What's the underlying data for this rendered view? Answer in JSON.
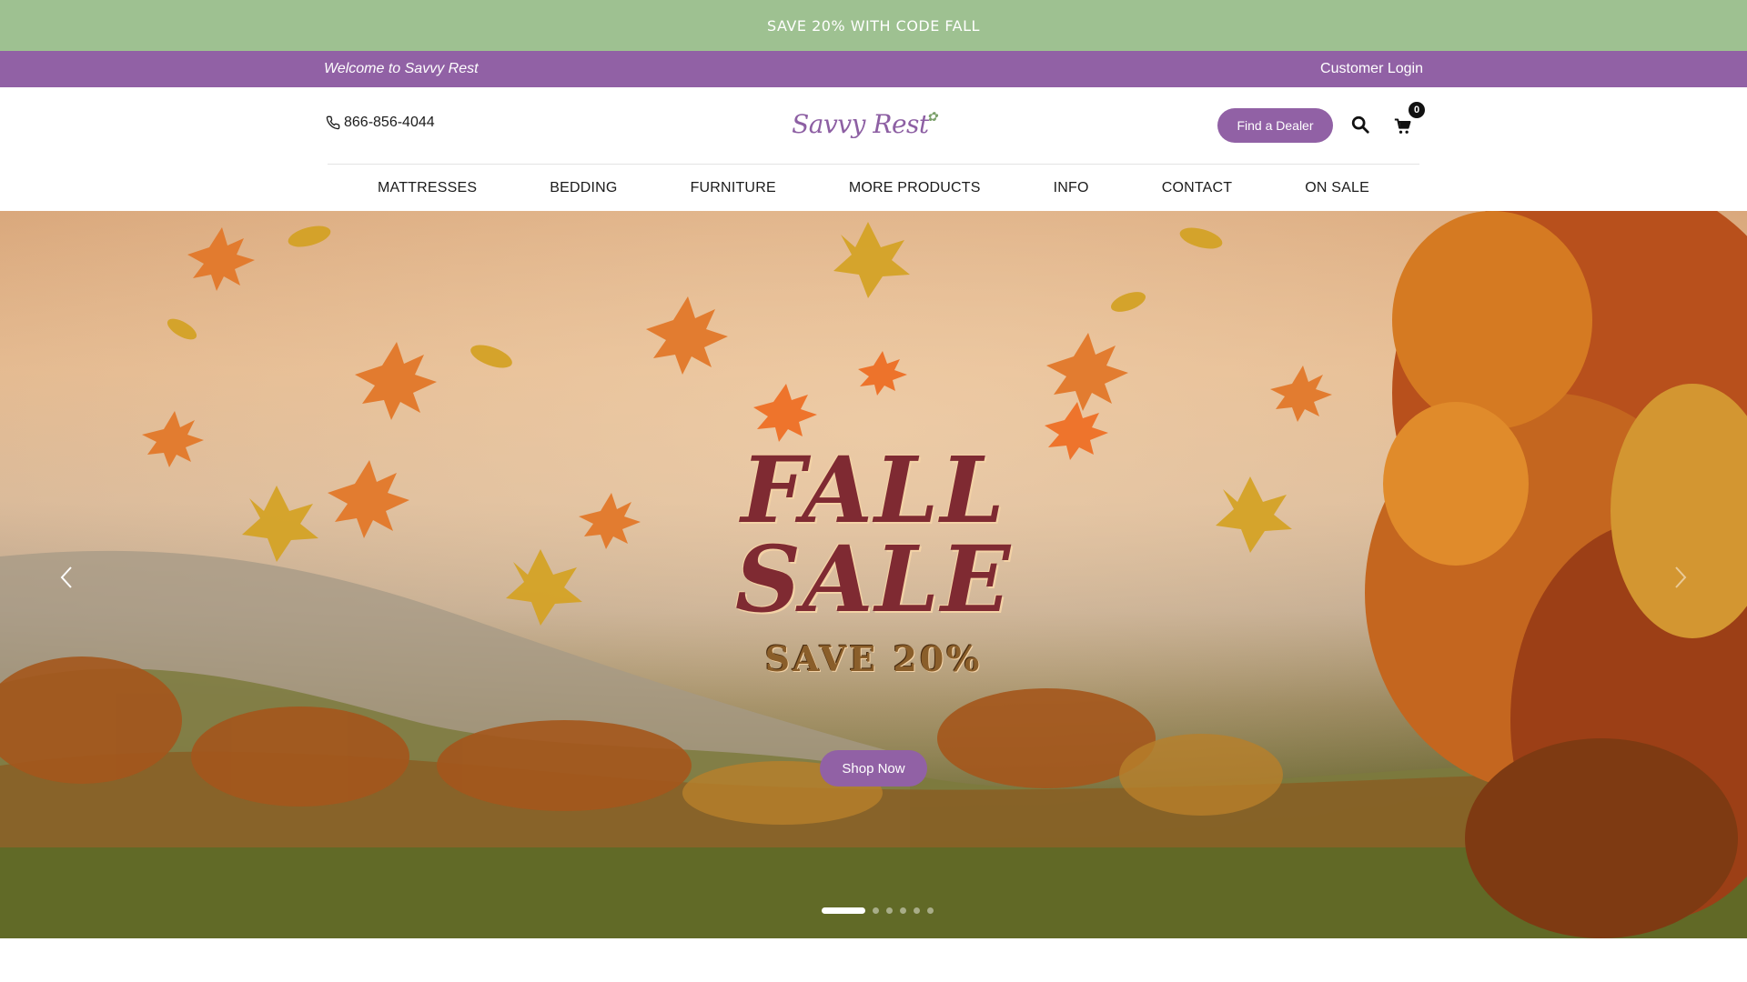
{
  "promo": {
    "text": "SAVE 20% WITH CODE FALL"
  },
  "utility": {
    "welcome": "Welcome to Savvy Rest",
    "login": "Customer Login"
  },
  "header": {
    "phone": "866-856-4044",
    "logo_text": "Savvy Rest",
    "dealer_button": "Find a Dealer",
    "cart_count": "0"
  },
  "nav": {
    "items": [
      {
        "label": "MATTRESSES"
      },
      {
        "label": "BEDDING"
      },
      {
        "label": "FURNITURE"
      },
      {
        "label": "MORE PRODUCTS"
      },
      {
        "label": "INFO"
      },
      {
        "label": "CONTACT"
      },
      {
        "label": "ON SALE"
      }
    ]
  },
  "hero": {
    "headline_line1": "FALL",
    "headline_line2": "SALE",
    "subhead": "SAVE 20%",
    "cta": "Shop Now",
    "slide_count": 6,
    "active_slide": 1
  },
  "colors": {
    "promo_bg": "#9ec191",
    "brand_purple": "#9161a5",
    "headline": "#7f2a32"
  },
  "icons": [
    "phone-icon",
    "search-icon",
    "cart-icon",
    "chevron-left-icon",
    "chevron-right-icon"
  ]
}
